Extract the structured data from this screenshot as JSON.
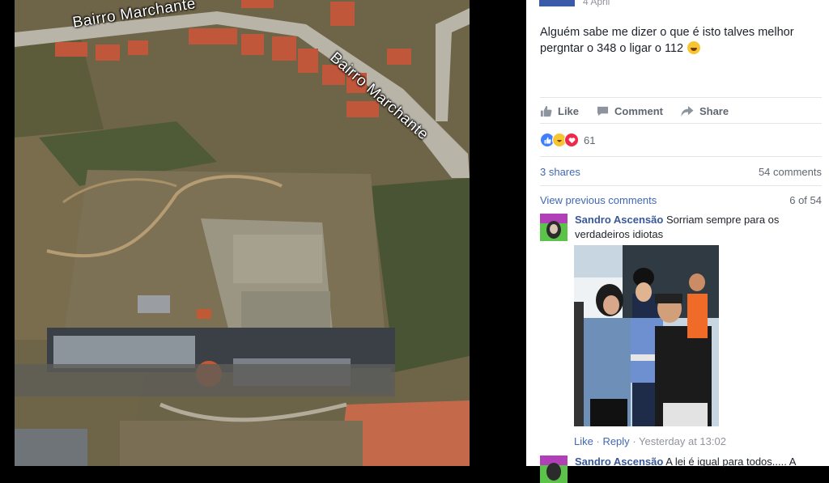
{
  "photo": {
    "street_label_1": "Bairro Marchante",
    "street_label_2": "Bairro Marchante"
  },
  "post": {
    "time": "4 April",
    "text": "Alguém sabe me dizer o que é isto talves melhor pergntar o 348 o ligar o 112",
    "actions": {
      "like": "Like",
      "comment": "Comment",
      "share": "Share"
    },
    "reaction_count": "61",
    "shares": "3 shares",
    "comments_count": "54 comments",
    "view_previous": "View previous comments",
    "pager": "6 of 54"
  },
  "comments": [
    {
      "author": "Sandro Ascensão",
      "text": "Sorriam sempre para os verdadeiros idiotas",
      "like": "Like",
      "reply": "Reply",
      "time": "Yesterday at 13:02"
    },
    {
      "author": "Sandro Ascensão",
      "text": "A lei é igual para todos..... A"
    }
  ],
  "colors": {
    "link": "#4267b2",
    "author": "#385898",
    "muted": "#90949c"
  },
  "icons": [
    "thumbs-up-icon",
    "comment-bubble-icon",
    "share-arrow-icon",
    "like-reaction-icon",
    "haha-reaction-icon",
    "love-reaction-icon"
  ]
}
